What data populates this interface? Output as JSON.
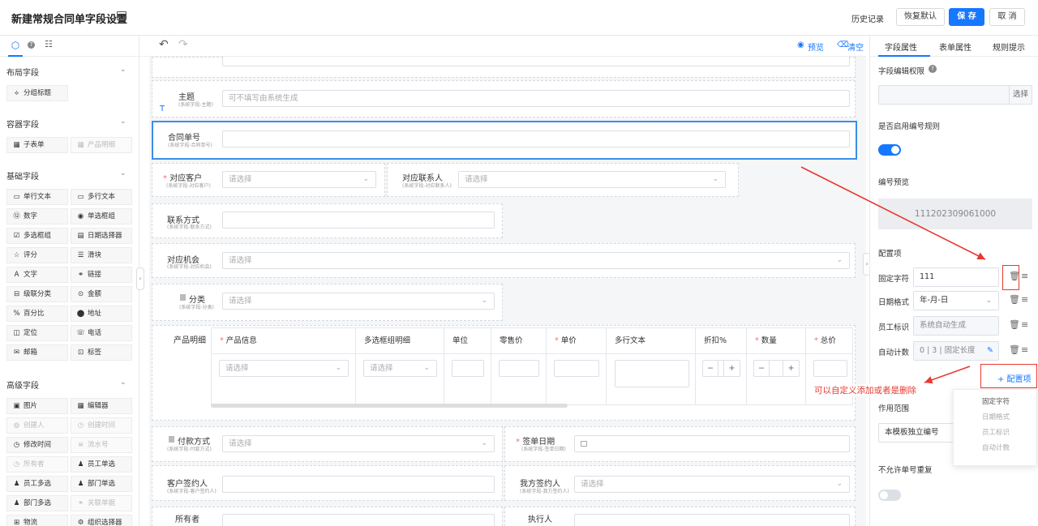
{
  "header": {
    "title": "新建常规合同单字段设置",
    "history": "历史记录",
    "restore": "恢复默认",
    "save": "保 存",
    "cancel": "取 消"
  },
  "toolbar": {
    "preview": "预览",
    "clear": "清空"
  },
  "left": {
    "layout_group": "布局字段",
    "layout_items": [
      "分组标题"
    ],
    "container_group": "容器字段",
    "container_items": [
      "子表单",
      "产品明细"
    ],
    "basic_group": "基础字段",
    "basic_items": [
      "单行文本",
      "多行文本",
      "数字",
      "单选框组",
      "多选框组",
      "日期选择器",
      "评分",
      "滑块",
      "文字",
      "链接",
      "级联分类",
      "金额",
      "百分比",
      "地址",
      "定位",
      "电话",
      "邮箱",
      "标签"
    ],
    "advanced_group": "高级字段",
    "advanced_items": [
      "图片",
      "编辑器",
      "创建人",
      "创建时间",
      "修改时间",
      "流水号",
      "所有者",
      "员工单选",
      "员工多选",
      "部门单选",
      "部门多选",
      "关联单据",
      "物流",
      "组织选择器"
    ]
  },
  "form": {
    "subject_label": "主题",
    "subject_sub": "(系统字段-主题)",
    "subject_placeholder": "可不填写由系统生成",
    "subject_type": "T",
    "contract_no_label": "合同单号",
    "contract_no_sub": "(系统字段-合同单号)",
    "customer_label": "对应客户",
    "customer_sub": "(系统字段-对应客户)",
    "select_placeholder": "请选择",
    "contact_label": "对应联系人",
    "contact_sub": "(系统字段-对应联系人)",
    "contact_way_label": "联系方式",
    "contact_way_sub": "(系统字段-联系方式)",
    "opportunity_label": "对应机会",
    "opportunity_sub": "(系统字段-对应机会)",
    "category_label": "分类",
    "category_sub": "(系统字段-分类)",
    "product_label": "产品明细",
    "product_columns": [
      "产品信息",
      "多选框组明细",
      "单位",
      "零售价",
      "单价",
      "多行文本",
      "折扣%",
      "数量",
      "总价"
    ],
    "payment_label": "付款方式",
    "payment_sub": "(系统字段-付款方式)",
    "signdate_label": "签单日期",
    "signdate_sub": "(系统字段-签单日期)",
    "cust_signer_label": "客户签约人",
    "cust_signer_sub": "(系统字段-客户签约人)",
    "our_signer_label": "我方签约人",
    "our_signer_sub": "(系统字段-我方签约人)",
    "owner_label": "所有者",
    "executor_label": "执行人"
  },
  "right": {
    "tabs": [
      "字段属性",
      "表单属性",
      "规则提示"
    ],
    "edit_perm_label": "字段编辑权限",
    "select_btn": "选择",
    "enable_rule_label": "是否启用编号规则",
    "preview_label": "编号预览",
    "preview_value": "111202309061000",
    "config_label": "配置项",
    "config_rows": [
      {
        "label": "固定字符",
        "value": "111"
      },
      {
        "label": "日期格式",
        "value": "年-月-日"
      },
      {
        "label": "员工标识",
        "value": "系统自动生成"
      },
      {
        "label": "自动计数",
        "value": "0 | 3 | 固定长度"
      }
    ],
    "add_config": "+ 配置项",
    "dropdown": [
      "固定字符",
      "日期格式",
      "员工标识",
      "自动计数"
    ],
    "scope_label": "作用范围",
    "scope_value": "本模板独立编号",
    "no_dup_label": "不允许单号重复"
  },
  "annotation": "可以自定义添加或者是删除",
  "colors": {
    "primary": "#1677ff",
    "annotation": "#e8382f"
  }
}
